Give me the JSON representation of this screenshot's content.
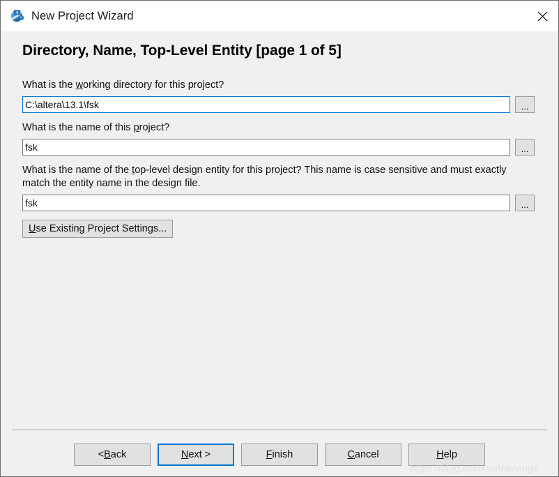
{
  "window": {
    "title": "New Project Wizard",
    "icon": "quartus-globe-icon",
    "close_label": "✕",
    "accent_color": "#0078d7",
    "body_color": "#f0f0f0",
    "titlebar_color": "#ffffff"
  },
  "page": {
    "heading": "Directory, Name, Top-Level Entity [page 1 of 5]"
  },
  "fields": {
    "working_directory": {
      "label_before": "What is the ",
      "label_mnemonic": "w",
      "label_after": "orking directory for this project?",
      "value": "C:\\altera\\13.1\\fsk",
      "placeholder": "",
      "browse_label": "...",
      "focused": true
    },
    "project_name": {
      "label_before": "What is the name of this ",
      "label_mnemonic": "p",
      "label_after": "roject?",
      "value": "fsk",
      "placeholder": "",
      "browse_label": "...",
      "focused": false
    },
    "top_level_entity": {
      "label_before": "What is the name of the ",
      "label_mnemonic": "t",
      "label_after": "op-level design entity for this project? This name is case sensitive and must exactly match the entity name in the design file.",
      "value": "fsk",
      "placeholder": "",
      "browse_label": "...",
      "focused": false
    }
  },
  "settings_button": {
    "mnemonic": "U",
    "rest": "se Existing Project Settings..."
  },
  "buttons": [
    {
      "name": "back",
      "before": "< ",
      "mnemonic": "B",
      "after": "ack",
      "default": false
    },
    {
      "name": "next",
      "before": "",
      "mnemonic": "N",
      "after": "ext >",
      "default": true
    },
    {
      "name": "finish",
      "before": "",
      "mnemonic": "F",
      "after": "inish",
      "default": false
    },
    {
      "name": "cancel",
      "before": "",
      "mnemonic": "C",
      "after": "ancel",
      "default": false
    },
    {
      "name": "help",
      "before": "",
      "mnemonic": "H",
      "after": "elp",
      "default": false
    }
  ],
  "watermark": "https://blog.csdn.net/dovings"
}
